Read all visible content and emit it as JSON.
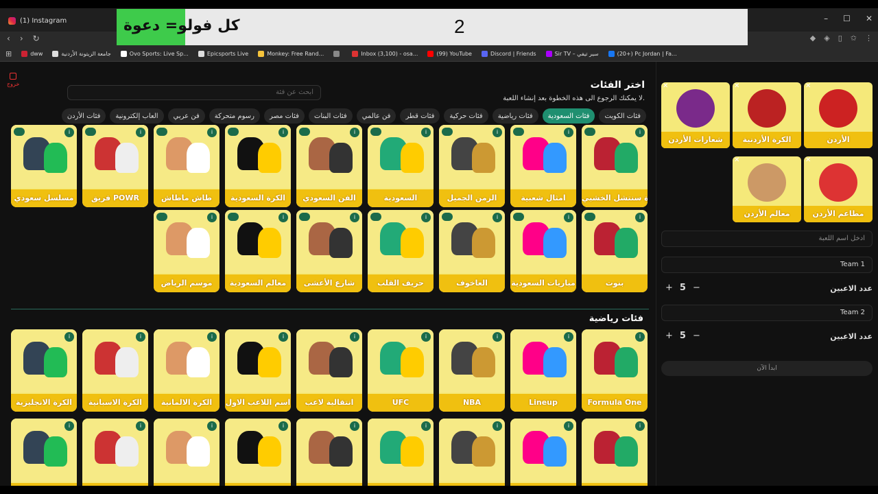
{
  "browser": {
    "tab_title": "(1) Instagram",
    "window_controls": [
      "–",
      "☐",
      "✕"
    ],
    "bookmarks": [
      {
        "label": "dww",
        "color": "#c23"
      },
      {
        "label": "جامعة الزيتونة الأردنية",
        "color": "#ddd"
      },
      {
        "label": "Ovo Sports: Live Sp...",
        "color": "#fff"
      },
      {
        "label": "Epicsports Live",
        "color": "#ddd"
      },
      {
        "label": "Monkey: Free Rand...",
        "color": "#f5c33b"
      },
      {
        "label": "",
        "color": "#888"
      },
      {
        "label": "Inbox (3,100) - osa...",
        "color": "#d33"
      },
      {
        "label": "(99) YouTube",
        "color": "#f00"
      },
      {
        "label": "Discord | Friends",
        "color": "#5865f2"
      },
      {
        "label": "Sir TV – سير تيفي",
        "color": "#a0f"
      },
      {
        "label": "(20+) Pc Jordan | Fa...",
        "color": "#1877f2"
      }
    ]
  },
  "overlay": {
    "caption": "كل فولو= دعوة",
    "counter": "2"
  },
  "header": {
    "exit_label": "خروج",
    "title": "اختر الفئات",
    "subtitle": "لا يمكنك الرجوع الى هذه الخطوة بعد إنشاء اللعبة.",
    "search_placeholder": "ابحث عن فئة"
  },
  "chips": [
    {
      "label": "فئات الكويت",
      "active": false
    },
    {
      "label": "فئات السعودية",
      "active": true
    },
    {
      "label": "فئات رياضية",
      "active": false
    },
    {
      "label": "فئات حركية",
      "active": false
    },
    {
      "label": "فئات قطر",
      "active": false
    },
    {
      "label": "فن عالمي",
      "active": false
    },
    {
      "label": "فئات البنات",
      "active": false
    },
    {
      "label": "فئات مصر",
      "active": false
    },
    {
      "label": "رسوم متحركة",
      "active": false
    },
    {
      "label": "فن عربي",
      "active": false
    },
    {
      "label": "العاب إلكترونية",
      "active": false
    },
    {
      "label": "فئات الأردن",
      "active": false
    }
  ],
  "saudi_row1": [
    "سورة سنتشل الخشبي",
    "امثال شعبية",
    "الزمن الجميل",
    "السعودية",
    "الفن السعودي",
    "الكرة السعودية",
    "طاش ماطاش",
    "فريق POWR",
    "مسلسل سعودي"
  ],
  "saudi_row2": [
    "بنوت",
    "مباريات السعودية",
    "العاخوف",
    "حريف القلب",
    "شارع الأعشى",
    "معالم السعودية",
    "موسم الرياض"
  ],
  "sports_title": "فئات رياضية",
  "sports_row1": [
    "Formula One",
    "Lineup",
    "NBA",
    "UFC",
    "انتقالية لاعب",
    "اسم اللاعب الاول",
    "الكرة الالمانية",
    "الكرة الاسبانية",
    "الكرة الانجليزية"
  ],
  "sports_row2": [
    "",
    "",
    "",
    "",
    "",
    "",
    "",
    "",
    ""
  ],
  "selected": [
    {
      "label": "الأردن"
    },
    {
      "label": "الكرة الأردنية"
    },
    {
      "label": "شعارات الأردن"
    },
    {
      "label": "مطاعم الأردن"
    },
    {
      "label": "معالم الأردن"
    }
  ],
  "form": {
    "game_name_placeholder": "ادخل اسم اللعبة",
    "team1": "Team 1",
    "team2": "Team 2",
    "players_label": "عدد الاعبين",
    "team1_players": "5",
    "team2_players": "5",
    "start_label": "ابدأ الآن"
  },
  "colors": {
    "card_bg": "#f5e97a",
    "card_label": "#f0c010",
    "active_chip": "#1f8f70",
    "overlay_green": "#3ecb4b"
  }
}
